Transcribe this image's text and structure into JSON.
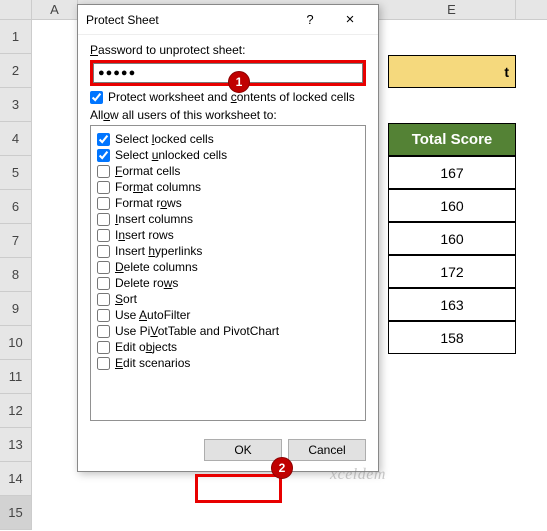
{
  "spreadsheet": {
    "columns": [
      "A",
      "E"
    ],
    "rows": [
      "1",
      "2",
      "3",
      "4",
      "5",
      "6",
      "7",
      "8",
      "9",
      "10",
      "11",
      "12",
      "13",
      "14",
      "15"
    ],
    "header": "Total Score",
    "data": [
      "167",
      "160",
      "160",
      "172",
      "163",
      "158"
    ],
    "title_hint": "t"
  },
  "dialog": {
    "title": "Protect Sheet",
    "help": "?",
    "close": "×",
    "pw_label": "Password to unprotect sheet:",
    "pw_value": "●●●●●",
    "protect_chk": "Protect worksheet and contents of locked cells",
    "allow_label": "Allow all users of this worksheet to:",
    "perms": [
      {
        "label": "Select locked cells",
        "u": "l",
        "pre": "Select ",
        "post": "ocked cells",
        "checked": true
      },
      {
        "label": "Select unlocked cells",
        "u": "u",
        "pre": "Select ",
        "post": "nlocked cells",
        "checked": true
      },
      {
        "label": "Format cells",
        "u": "F",
        "pre": "",
        "post": "ormat cells",
        "checked": false
      },
      {
        "label": "Format columns",
        "u": "m",
        "pre": "For",
        "post": "at columns",
        "checked": false
      },
      {
        "label": "Format rows",
        "u": "o",
        "pre": "Format r",
        "post": "ws",
        "checked": false
      },
      {
        "label": "Insert columns",
        "u": "I",
        "pre": "",
        "post": "nsert columns",
        "checked": false
      },
      {
        "label": "Insert rows",
        "u": "n",
        "pre": "I",
        "post": "sert rows",
        "checked": false
      },
      {
        "label": "Insert hyperlinks",
        "u": "h",
        "pre": "Insert ",
        "post": "yperlinks",
        "checked": false
      },
      {
        "label": "Delete columns",
        "u": "D",
        "pre": "",
        "post": "elete columns",
        "checked": false
      },
      {
        "label": "Delete rows",
        "u": "w",
        "pre": "Delete ro",
        "post": "s",
        "checked": false
      },
      {
        "label": "Sort",
        "u": "S",
        "pre": "",
        "post": "ort",
        "checked": false
      },
      {
        "label": "Use AutoFilter",
        "u": "A",
        "pre": "Use ",
        "post": "utoFilter",
        "checked": false
      },
      {
        "label": "Use PivotTable and PivotChart",
        "u": "V",
        "pre": "Use Pi",
        "post": "otTable and PivotChart",
        "checked": false
      },
      {
        "label": "Edit objects",
        "u": "b",
        "pre": "Edit o",
        "post": "jects",
        "checked": false
      },
      {
        "label": "Edit scenarios",
        "u": "E",
        "pre": "",
        "post": "dit scenarios",
        "checked": false
      }
    ],
    "ok": "OK",
    "cancel": "Cancel"
  },
  "callouts": {
    "one": "1",
    "two": "2"
  },
  "watermark": "xceldem"
}
